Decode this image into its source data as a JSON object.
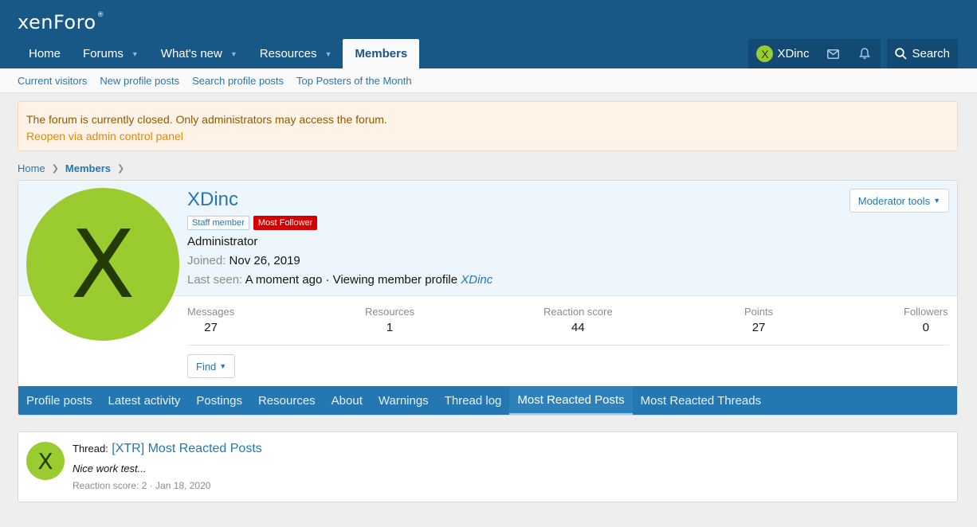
{
  "logo": {
    "text": "xenForo",
    "mark": "®"
  },
  "nav": {
    "tabs": [
      {
        "label": "Home",
        "caret": false
      },
      {
        "label": "Forums",
        "caret": true
      },
      {
        "label": "What's new",
        "caret": true
      },
      {
        "label": "Resources",
        "caret": true
      },
      {
        "label": "Members",
        "caret": false,
        "active": true
      }
    ],
    "user": {
      "initial": "X",
      "name": "XDinc"
    },
    "search_label": "Search"
  },
  "subnav": [
    "Current visitors",
    "New profile posts",
    "Search profile posts",
    "Top Posters of the Month"
  ],
  "notice": {
    "message": "The forum is currently closed. Only administrators may access the forum.",
    "link": "Reopen via admin control panel"
  },
  "breadcrumb": {
    "home": "Home",
    "members": "Members"
  },
  "profile": {
    "avatar_initial": "X",
    "username": "XDinc",
    "badge_staff": "Staff member",
    "badge_follower": "Most Follower",
    "role": "Administrator",
    "joined_label": "Joined:",
    "joined_value": "Nov 26, 2019",
    "last_seen_label": "Last seen:",
    "last_seen_value": "A moment ago · Viewing member profile",
    "last_seen_link": "XDinc",
    "moderator_tools": "Moderator tools",
    "find": "Find",
    "stats": [
      {
        "label": "Messages",
        "value": "27"
      },
      {
        "label": "Resources",
        "value": "1"
      },
      {
        "label": "Reaction score",
        "value": "44"
      },
      {
        "label": "Points",
        "value": "27"
      },
      {
        "label": "Followers",
        "value": "0"
      }
    ],
    "tabs": [
      "Profile posts",
      "Latest activity",
      "Postings",
      "Resources",
      "About",
      "Warnings",
      "Thread log",
      "Most Reacted Posts",
      "Most Reacted Threads"
    ],
    "active_tab": "Most Reacted Posts"
  },
  "post": {
    "avatar_initial": "X",
    "prefix": "Thread:",
    "title": "[XTR] Most Reacted Posts",
    "snippet": "Nice work test...",
    "meta": "Reaction score: 2 · Jan 18, 2020"
  },
  "colors": {
    "header": "#185886",
    "accent": "#2577b1",
    "avatar": "#9bcc2f",
    "notice_bg": "#fef3e6",
    "badge_red": "#d40000"
  }
}
